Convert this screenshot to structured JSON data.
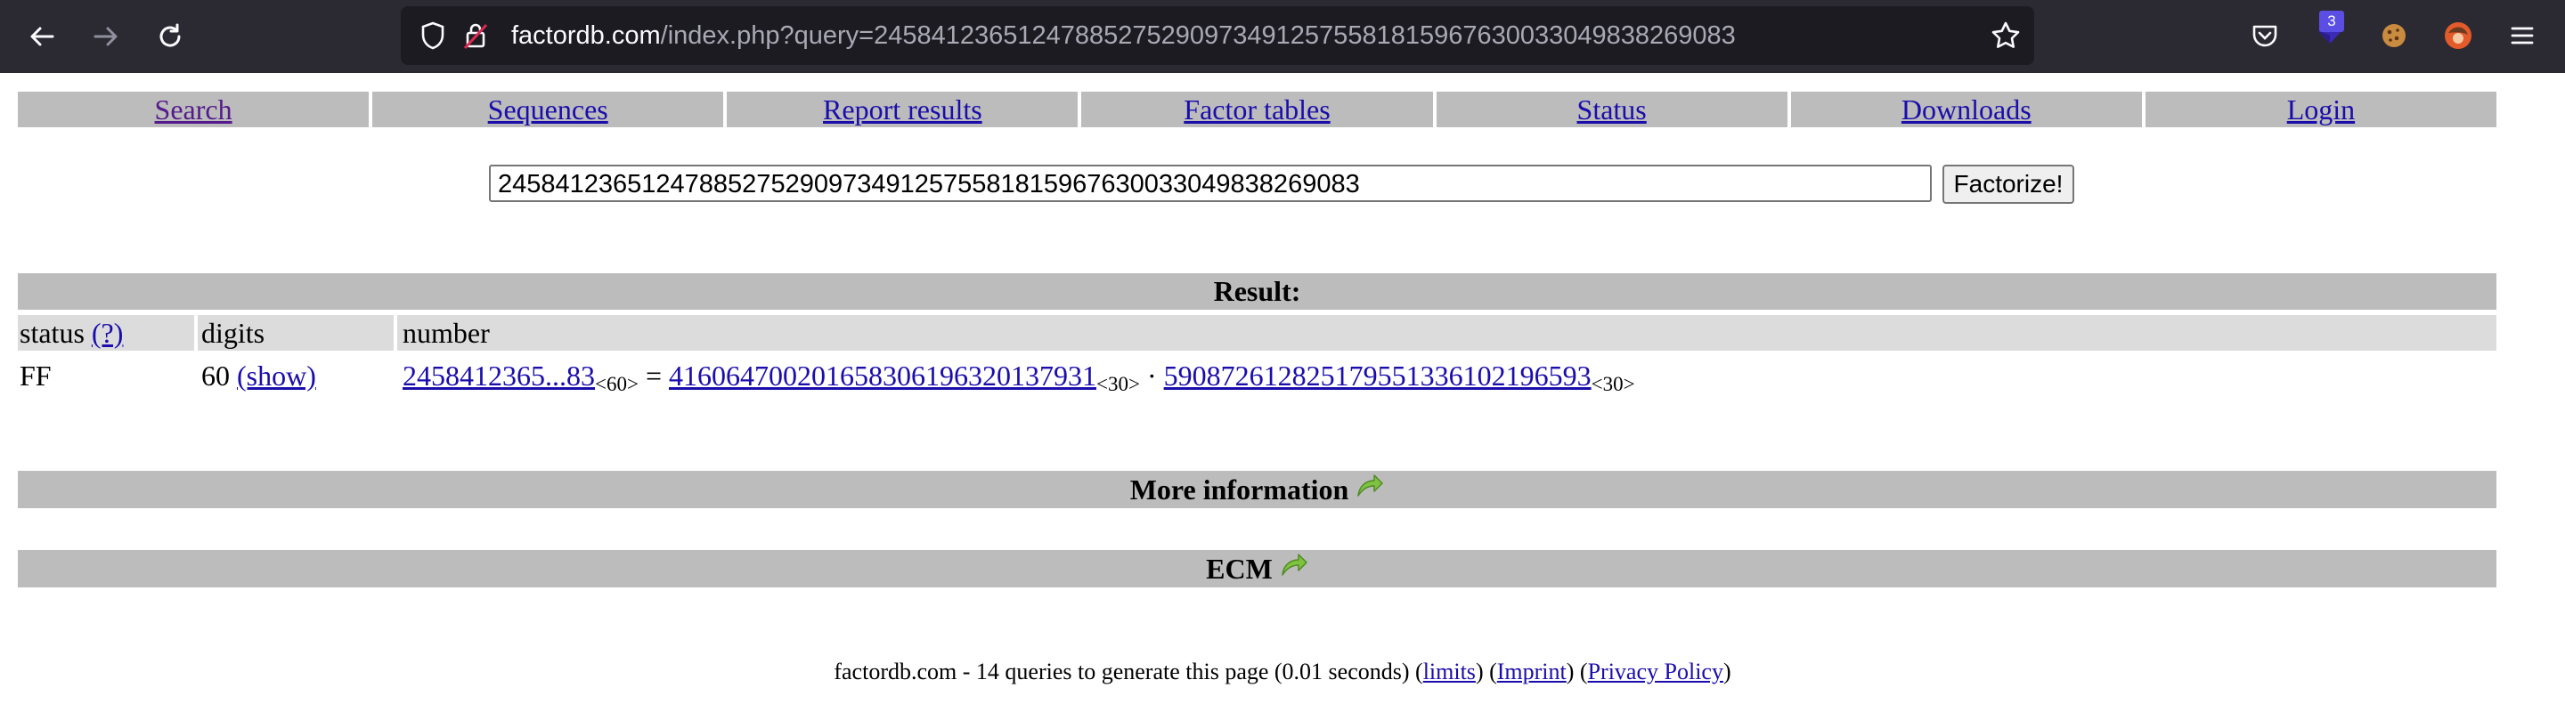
{
  "browser": {
    "url_host": "factordb.com",
    "url_path": "/index.php?query=245841236512478852752909734912575581815967630033049838269083",
    "extension_badge": "3"
  },
  "nav": {
    "items": [
      {
        "label": "Search"
      },
      {
        "label": "Sequences"
      },
      {
        "label": "Report results"
      },
      {
        "label": "Factor tables"
      },
      {
        "label": "Status"
      },
      {
        "label": "Downloads"
      },
      {
        "label": "Login"
      }
    ]
  },
  "search": {
    "value": "245841236512478852752909734912575581815967630033049838269083",
    "button_label": "Factorize!"
  },
  "result": {
    "heading": "Result:",
    "headers": {
      "status": "status",
      "status_help": "(?)",
      "digits": "digits",
      "number": "number"
    },
    "row": {
      "status": "FF",
      "digits": "60",
      "show_link": "(show)",
      "number_short": "2458412365...83",
      "number_size": "<60>",
      "equals": "=",
      "factor1": "416064700201658306196320137931",
      "factor1_size": "<30>",
      "dot": "·",
      "factor2": "590872612825179551336102196593",
      "factor2_size": "<30>"
    }
  },
  "sections": {
    "more_info": "More information",
    "ecm": "ECM"
  },
  "footer": {
    "text": "factordb.com - 14 queries to generate this page (0.01 seconds) (",
    "limits": "limits",
    "sep1": ") (",
    "imprint": "Imprint",
    "sep2": ") (",
    "privacy": "Privacy Policy",
    "end": ")"
  },
  "colors": {
    "chrome_bg": "#2b2a33",
    "urlbar_bg": "#1c1b22",
    "bar_gray": "#bcbcbc",
    "subheader_gray": "#dcdcdc",
    "link": "#1a0dab",
    "visited": "#551a8b"
  }
}
